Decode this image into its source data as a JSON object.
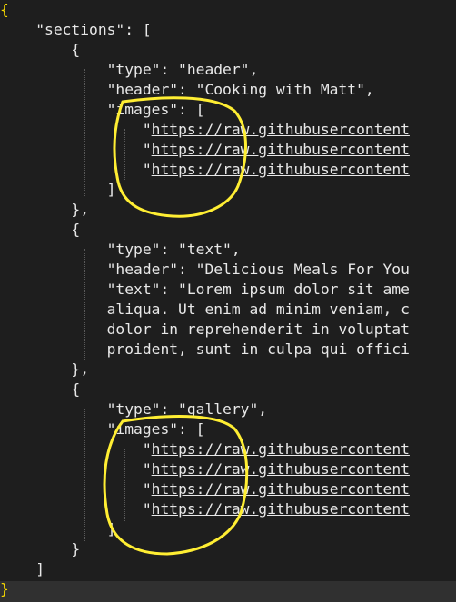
{
  "colors": {
    "background": "#1e1e1e",
    "text": "#e8e8e8",
    "outer_brace": "#f5d800",
    "annotation_circle": "#ffee33",
    "status_bar": "#303030"
  },
  "code_lines": [
    "{",
    "    \"sections\": [",
    "        {",
    "            \"type\": \"header\",",
    "            \"header\": \"Cooking with Matt\",",
    "            \"images\": [",
    "                \"https://raw.githubusercontent",
    "                \"https://raw.githubusercontent",
    "                \"https://raw.githubusercontent",
    "            ]",
    "        },",
    "        {",
    "            \"type\": \"text\",",
    "            \"header\": \"Delicious Meals For You",
    "            \"text\": \"Lorem ipsum dolor sit ame",
    "            aliqua. Ut enim ad minim veniam, c",
    "            dolor in reprehenderit in voluptat",
    "            proident, sunt in culpa qui offici",
    "        },",
    "        {",
    "            \"type\": \"gallery\",",
    "            \"images\": [",
    "                \"https://raw.githubusercontent",
    "                \"https://raw.githubusercontent",
    "                \"https://raw.githubusercontent",
    "                \"https://raw.githubusercontent",
    "            ]",
    "        }",
    "    ]",
    "}"
  ],
  "url_parts": {
    "quote": "\"",
    "link": "https://raw.githubusercontent"
  },
  "annotations": [
    {
      "shape": "hand-drawn-circle",
      "encloses": "header section images list"
    },
    {
      "shape": "hand-drawn-circle",
      "encloses": "gallery section images list"
    }
  ]
}
